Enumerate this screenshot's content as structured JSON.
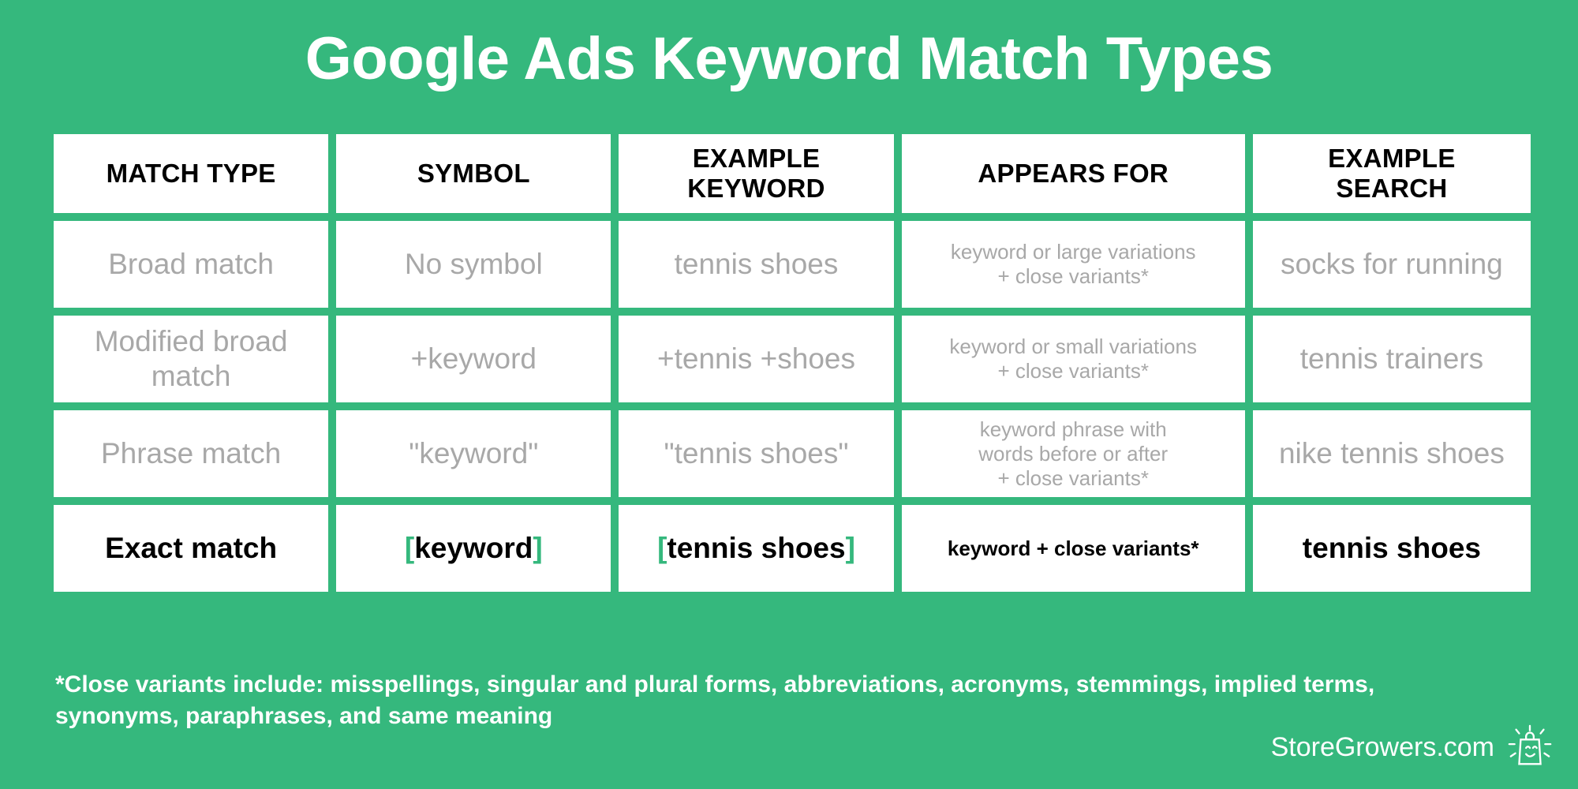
{
  "title": "Google Ads Keyword Match Types",
  "theme": {
    "background_green": "#35b87d",
    "cell_background": "#ffffff",
    "muted_text": "#a8a8a8",
    "strong_text": "#000000",
    "bracket_accent": "#35b87d"
  },
  "table": {
    "headers": [
      {
        "label": "MATCH TYPE"
      },
      {
        "label": "SYMBOL"
      },
      {
        "label": "EXAMPLE\nKEYWORD"
      },
      {
        "label": "APPEARS FOR"
      },
      {
        "label": "EXAMPLE\nSEARCH"
      }
    ],
    "rows": [
      {
        "match_type": "Broad match",
        "symbol": "No symbol",
        "example_keyword": "tennis shoes",
        "appears_for": "keyword or large variations\n+ close variants*",
        "example_search": "socks for running",
        "emphasis": "muted"
      },
      {
        "match_type": "Modified broad\nmatch",
        "symbol": "+keyword",
        "example_keyword": "+tennis +shoes",
        "appears_for": "keyword or small variations\n+ close variants*",
        "example_search": "tennis trainers",
        "emphasis": "muted"
      },
      {
        "match_type": "Phrase match",
        "symbol": "\"keyword\"",
        "example_keyword": "\"tennis shoes\"",
        "appears_for": "keyword phrase with\nwords before or after\n+ close variants*",
        "example_search": "nike tennis shoes",
        "emphasis": "muted"
      },
      {
        "match_type": "Exact match",
        "symbol_bracket_open": "[",
        "symbol_core": "keyword",
        "symbol_bracket_close": "]",
        "keyword_bracket_open": "[",
        "keyword_core": "tennis shoes",
        "keyword_bracket_close": "]",
        "appears_for": "keyword + close variants*",
        "example_search": "tennis shoes",
        "emphasis": "strong"
      }
    ]
  },
  "footnote": {
    "line1": "*Close variants include: misspellings, singular and plural forms, abbreviations, acronyms, stemmings, implied terms,",
    "line2": "synonyms, paraphrases, and same meaning"
  },
  "branding": {
    "text": "StoreGrowers.com",
    "logo_icon": "shopping-bag-smile-icon"
  }
}
